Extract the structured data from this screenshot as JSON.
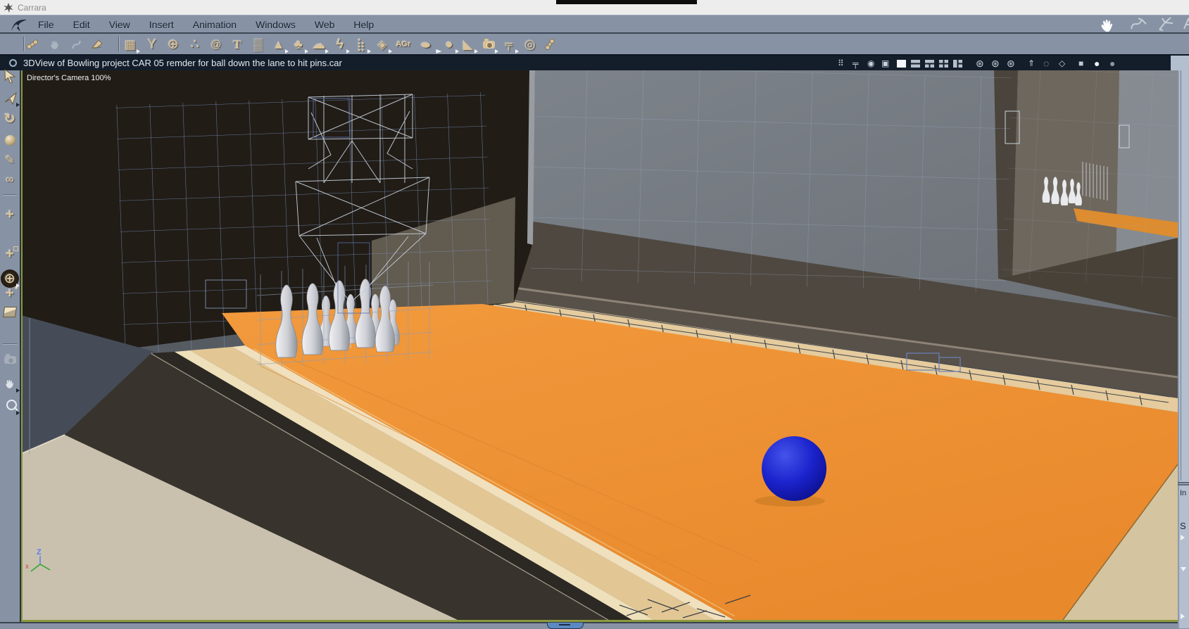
{
  "window": {
    "app_title": "Carrara"
  },
  "menu": {
    "items": [
      "File",
      "Edit",
      "View",
      "Insert",
      "Animation",
      "Windows",
      "Web",
      "Help"
    ]
  },
  "toolbar": {
    "agr_label": "AGr"
  },
  "viewport": {
    "title": "3DView of Bowling project CAR 05 remder for ball down the lane to hit pins.car",
    "camera_label": "Director's Camera 100%"
  },
  "right_panel": {
    "instances_tab": "In",
    "sequencer_tab": "S"
  },
  "axis": {
    "z_label": "Z",
    "x_label": "x"
  },
  "colors": {
    "lane_orange": "#EF9435",
    "gutter_beige": "#E5CB9D",
    "ball_blue": "#1B23CC",
    "wireframe_blue": "#7590B8",
    "chrome_slate": "#8793A5",
    "titlebar_navy": "#141E2B"
  }
}
